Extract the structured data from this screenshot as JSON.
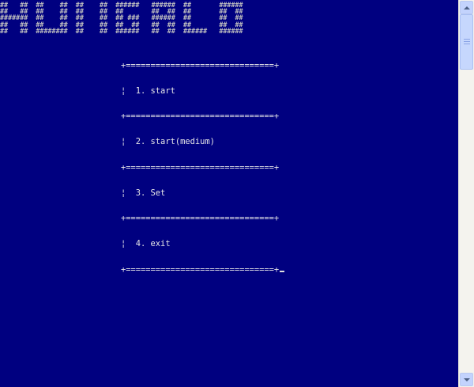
{
  "banner": {
    "lines": [
      "##   ##  ##    ##  ##    ##  ######   ######  ##       ######",
      "##   ##  ##    ##  ##    ##  ##       ##  ##  ##       ##  ##",
      "#######  ##    ##  ##    ##  ## ###   ######  ##       ##  ##",
      "##   ##  ##    ##  ##    ##  ##  ##   ##  ##  ##       ##  ##",
      "##   ##  ########  ##    ##  ######   ##  ##  ######   ######"
    ]
  },
  "menu": {
    "border_line": "+==============================+",
    "items": [
      {
        "label": "1. start"
      },
      {
        "label": "2. start(medium)"
      },
      {
        "label": "3. Set"
      },
      {
        "label": "4. exit"
      }
    ]
  },
  "scrollbar": {
    "up_icon": "arrow-up-icon",
    "down_icon": "arrow-down-icon"
  },
  "colors": {
    "console_background": "#000080",
    "console_text": "#c0c0c0"
  }
}
